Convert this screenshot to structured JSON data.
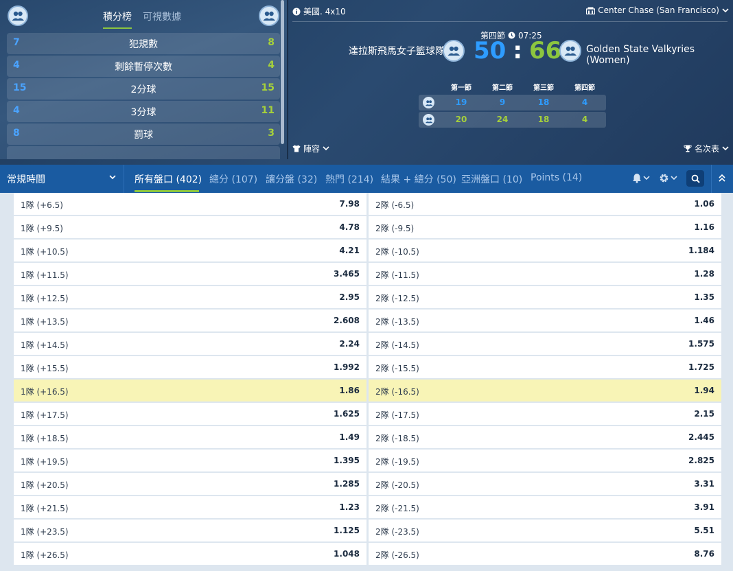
{
  "stats_panel": {
    "tabs": [
      {
        "label": "積分榜",
        "active": true
      },
      {
        "label": "可視數據",
        "active": false
      }
    ],
    "rows": [
      {
        "left": "7",
        "label": "犯規數",
        "right": "8"
      },
      {
        "left": "4",
        "label": "剩餘暫停次數",
        "right": "4"
      },
      {
        "left": "15",
        "label": "2分球",
        "right": "15"
      },
      {
        "left": "4",
        "label": "3分球",
        "right": "11"
      },
      {
        "left": "8",
        "label": "罰球",
        "right": "3"
      }
    ]
  },
  "match": {
    "country": "美國. 4x10",
    "venue": "Center Chase (San Francisco)",
    "period": "第四節",
    "clock": "07:25",
    "team1": "達拉斯飛馬女子籃球隊",
    "team2": "Golden State Valkyries (Women)",
    "score1": "50",
    "score_sep": ":",
    "score2": "66",
    "quarters": {
      "headers": [
        "第一節",
        "第二節",
        "第三節",
        "第四節"
      ],
      "team1": [
        "19",
        "9",
        "18",
        "4"
      ],
      "team2": [
        "20",
        "24",
        "18",
        "4"
      ]
    },
    "lineup_label": "陣容",
    "rankings_label": "名次表"
  },
  "market_bar": {
    "period_select": "常規時間",
    "tabs": [
      {
        "label": "所有盤口 (402)",
        "active": true
      },
      {
        "label": "總分 (107)",
        "active": false
      },
      {
        "label": "讓分盤 (32)",
        "active": false
      },
      {
        "label": "熱門 (214)",
        "active": false
      },
      {
        "label": "結果 + 總分 (50)",
        "active": false
      },
      {
        "label": "亞洲盤口 (10)",
        "active": false
      },
      {
        "label": "Points (14)",
        "active": false
      }
    ]
  },
  "odds_rows": [
    {
      "left_label": "1隊 (+6.5)",
      "left_value": "7.98",
      "right_label": "2隊 (-6.5)",
      "right_value": "1.06",
      "highlight": false
    },
    {
      "left_label": "1隊 (+9.5)",
      "left_value": "4.78",
      "right_label": "2隊 (-9.5)",
      "right_value": "1.16",
      "highlight": false
    },
    {
      "left_label": "1隊 (+10.5)",
      "left_value": "4.21",
      "right_label": "2隊 (-10.5)",
      "right_value": "1.184",
      "highlight": false
    },
    {
      "left_label": "1隊 (+11.5)",
      "left_value": "3.465",
      "right_label": "2隊 (-11.5)",
      "right_value": "1.28",
      "highlight": false
    },
    {
      "left_label": "1隊 (+12.5)",
      "left_value": "2.95",
      "right_label": "2隊 (-12.5)",
      "right_value": "1.35",
      "highlight": false
    },
    {
      "left_label": "1隊 (+13.5)",
      "left_value": "2.608",
      "right_label": "2隊 (-13.5)",
      "right_value": "1.46",
      "highlight": false
    },
    {
      "left_label": "1隊 (+14.5)",
      "left_value": "2.24",
      "right_label": "2隊 (-14.5)",
      "right_value": "1.575",
      "highlight": false
    },
    {
      "left_label": "1隊 (+15.5)",
      "left_value": "1.992",
      "right_label": "2隊 (-15.5)",
      "right_value": "1.725",
      "highlight": false
    },
    {
      "left_label": "1隊 (+16.5)",
      "left_value": "1.86",
      "right_label": "2隊 (-16.5)",
      "right_value": "1.94",
      "highlight": true
    },
    {
      "left_label": "1隊 (+17.5)",
      "left_value": "1.625",
      "right_label": "2隊 (-17.5)",
      "right_value": "2.15",
      "highlight": false
    },
    {
      "left_label": "1隊 (+18.5)",
      "left_value": "1.49",
      "right_label": "2隊 (-18.5)",
      "right_value": "2.445",
      "highlight": false
    },
    {
      "left_label": "1隊 (+19.5)",
      "left_value": "1.395",
      "right_label": "2隊 (-19.5)",
      "right_value": "2.825",
      "highlight": false
    },
    {
      "left_label": "1隊 (+20.5)",
      "left_value": "1.285",
      "right_label": "2隊 (-20.5)",
      "right_value": "3.31",
      "highlight": false
    },
    {
      "left_label": "1隊 (+21.5)",
      "left_value": "1.23",
      "right_label": "2隊 (-21.5)",
      "right_value": "3.91",
      "highlight": false
    },
    {
      "left_label": "1隊 (+23.5)",
      "left_value": "1.125",
      "right_label": "2隊 (-23.5)",
      "right_value": "5.51",
      "highlight": false
    },
    {
      "left_label": "1隊 (+26.5)",
      "left_value": "1.048",
      "right_label": "2隊 (-26.5)",
      "right_value": "8.76",
      "highlight": false
    }
  ],
  "colors": {
    "home": "#2e9cff",
    "away": "#8cc63f",
    "highlight": "#f8f4b6",
    "bar": "#1a5ba1"
  },
  "icons": [
    "team-avatar-icon",
    "info-icon",
    "stadium-icon",
    "clock-icon",
    "jersey-icon",
    "trophy-icon",
    "bell-icon",
    "gear-icon",
    "search-icon",
    "collapse-icon"
  ]
}
